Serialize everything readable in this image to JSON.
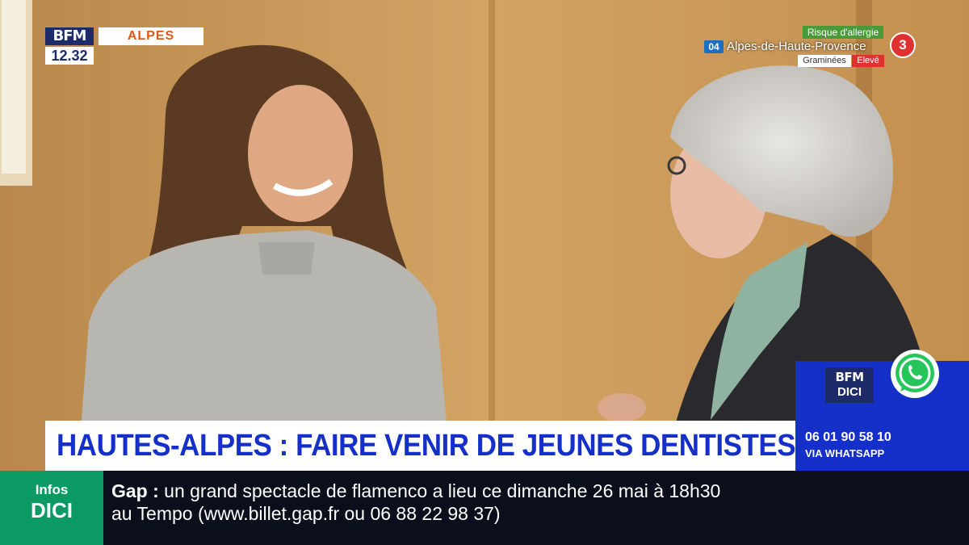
{
  "logo": {
    "brand": "BFM",
    "region": "ALPES",
    "time": "12.32"
  },
  "allergy": {
    "title": "Risque d'allergie",
    "dept": "04",
    "area": "Alpes-de-Haute-Provence",
    "pollen": "Graminées",
    "level": "Elevé",
    "level_num": "3"
  },
  "whatsapp": {
    "brand_l1": "BFM",
    "brand_l2": "DICI",
    "phone": "06 01 90 58 10",
    "via": "VIA WHATSAPP"
  },
  "headline": "HAUTES-ALPES : FAIRE VENIR DE JEUNES DENTISTES",
  "ticker": {
    "tag_l1": "Infos",
    "tag_l2": "DICI",
    "place": "Gap :",
    "line1": "un grand spectacle de flamenco a lieu ce dimanche 26 mai à 18h30",
    "line2": "au Tempo  (www.billet.gap.fr ou 06 88 22 98 37)"
  },
  "colors": {
    "headline_text": "#1530c8",
    "ticker_tag": "#0c9a64",
    "whatsapp_panel": "#1530c8",
    "region_text": "#e2561a"
  }
}
